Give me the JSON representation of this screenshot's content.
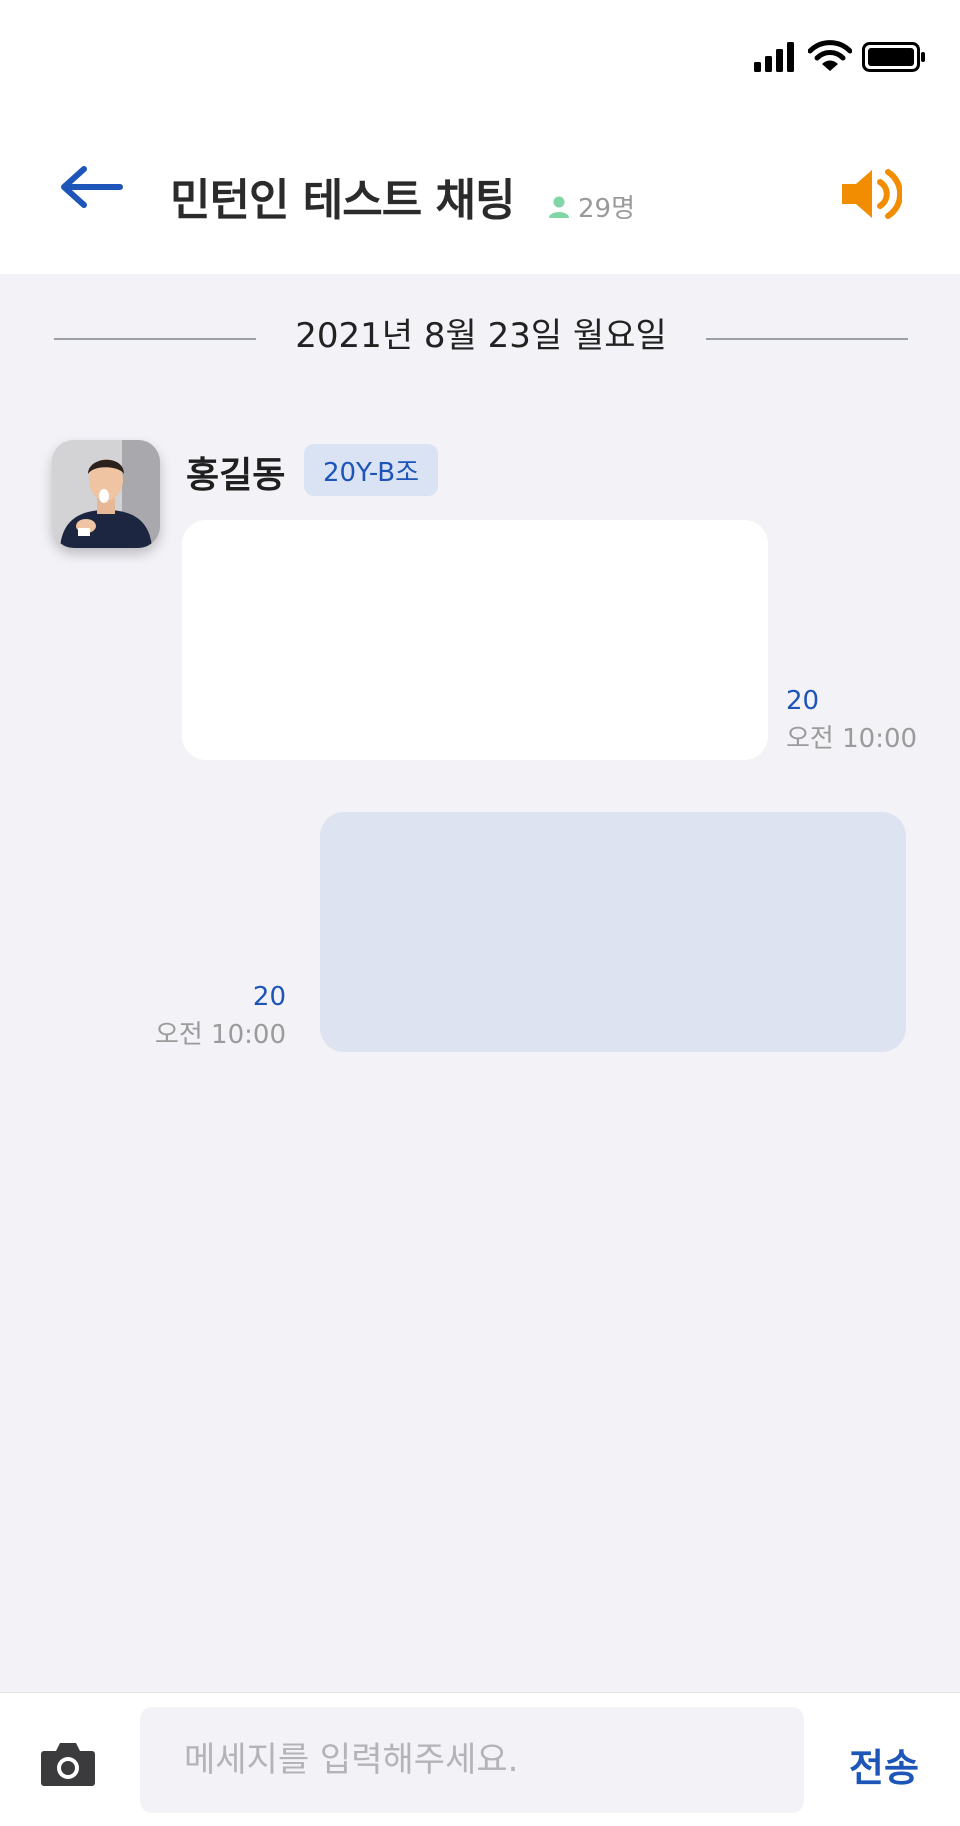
{
  "header": {
    "title": "민턴인 테스트 채팅",
    "member_count": "29명",
    "accent_color": "#1d55b8",
    "speaker_color": "#f28c00"
  },
  "chat": {
    "date_divider": "2021년 8월 23일 월요일",
    "messages": [
      {
        "direction": "incoming",
        "sender": "홍길동",
        "group": "20Y-B조",
        "read_count": "20",
        "time": "오전 10:00"
      },
      {
        "direction": "outgoing",
        "read_count": "20",
        "time": "오전 10:00"
      }
    ]
  },
  "input_bar": {
    "placeholder": "메세지를 입력해주세요.",
    "send_label": "전송"
  }
}
